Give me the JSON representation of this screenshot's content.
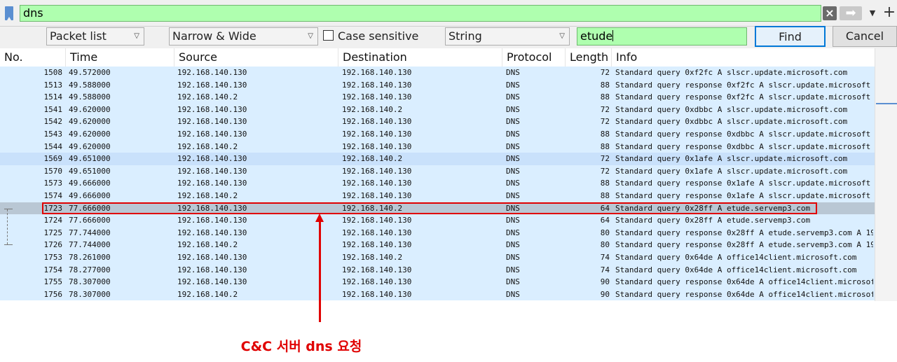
{
  "filter": {
    "value": "dns",
    "icons": {
      "bookmark": "bookmark-icon",
      "clear": "clear-x-icon",
      "apply": "arrow-right-icon",
      "history": "chevron-down-icon",
      "add": "plus-icon"
    }
  },
  "findbar": {
    "search_in": "Packet list",
    "char_width": "Narrow & Wide",
    "case_sensitive_label": "Case sensitive",
    "search_type": "String",
    "search_value": "etude",
    "find_label": "Find",
    "cancel_label": "Cancel"
  },
  "table": {
    "columns": [
      "No.",
      "Time",
      "Source",
      "Destination",
      "Protocol",
      "Length",
      "Info"
    ],
    "rows": [
      {
        "no": "1508",
        "time": "49.572000",
        "src": "192.168.140.130",
        "dst": "192.168.140.130",
        "proto": "DNS",
        "len": "72",
        "info": "Standard query 0xf2fc A slscr.update.microsoft.com"
      },
      {
        "no": "1513",
        "time": "49.588000",
        "src": "192.168.140.130",
        "dst": "192.168.140.130",
        "proto": "DNS",
        "len": "88",
        "info": "Standard query response 0xf2fc A slscr.update.microsoft"
      },
      {
        "no": "1514",
        "time": "49.588000",
        "src": "192.168.140.2",
        "dst": "192.168.140.130",
        "proto": "DNS",
        "len": "88",
        "info": "Standard query response 0xf2fc A slscr.update.microsoft"
      },
      {
        "no": "1541",
        "time": "49.620000",
        "src": "192.168.140.130",
        "dst": "192.168.140.2",
        "proto": "DNS",
        "len": "72",
        "info": "Standard query 0xdbbc A slscr.update.microsoft.com"
      },
      {
        "no": "1542",
        "time": "49.620000",
        "src": "192.168.140.130",
        "dst": "192.168.140.130",
        "proto": "DNS",
        "len": "72",
        "info": "Standard query 0xdbbc A slscr.update.microsoft.com"
      },
      {
        "no": "1543",
        "time": "49.620000",
        "src": "192.168.140.130",
        "dst": "192.168.140.130",
        "proto": "DNS",
        "len": "88",
        "info": "Standard query response 0xdbbc A slscr.update.microsoft"
      },
      {
        "no": "1544",
        "time": "49.620000",
        "src": "192.168.140.2",
        "dst": "192.168.140.130",
        "proto": "DNS",
        "len": "88",
        "info": "Standard query response 0xdbbc A slscr.update.microsoft"
      },
      {
        "no": "1569",
        "time": "49.651000",
        "src": "192.168.140.130",
        "dst": "192.168.140.2",
        "proto": "DNS",
        "len": "72",
        "info": "Standard query 0x1afe A slscr.update.microsoft.com"
      },
      {
        "no": "1570",
        "time": "49.651000",
        "src": "192.168.140.130",
        "dst": "192.168.140.130",
        "proto": "DNS",
        "len": "72",
        "info": "Standard query 0x1afe A slscr.update.microsoft.com"
      },
      {
        "no": "1573",
        "time": "49.666000",
        "src": "192.168.140.130",
        "dst": "192.168.140.130",
        "proto": "DNS",
        "len": "88",
        "info": "Standard query response 0x1afe A slscr.update.microsoft"
      },
      {
        "no": "1574",
        "time": "49.666000",
        "src": "192.168.140.2",
        "dst": "192.168.140.130",
        "proto": "DNS",
        "len": "88",
        "info": "Standard query response 0x1afe A slscr.update.microsoft"
      },
      {
        "no": "1723",
        "time": "77.666000",
        "src": "192.168.140.130",
        "dst": "192.168.140.2",
        "proto": "DNS",
        "len": "64",
        "info": "Standard query 0x28ff A etude.servemp3.com"
      },
      {
        "no": "1724",
        "time": "77.666000",
        "src": "192.168.140.130",
        "dst": "192.168.140.130",
        "proto": "DNS",
        "len": "64",
        "info": "Standard query 0x28ff A etude.servemp3.com"
      },
      {
        "no": "1725",
        "time": "77.744000",
        "src": "192.168.140.130",
        "dst": "192.168.140.130",
        "proto": "DNS",
        "len": "80",
        "info": "Standard query response 0x28ff A etude.servemp3.com A 19"
      },
      {
        "no": "1726",
        "time": "77.744000",
        "src": "192.168.140.2",
        "dst": "192.168.140.130",
        "proto": "DNS",
        "len": "80",
        "info": "Standard query response 0x28ff A etude.servemp3.com A 19"
      },
      {
        "no": "1753",
        "time": "78.261000",
        "src": "192.168.140.130",
        "dst": "192.168.140.2",
        "proto": "DNS",
        "len": "74",
        "info": "Standard query 0x64de A office14client.microsoft.com"
      },
      {
        "no": "1754",
        "time": "78.277000",
        "src": "192.168.140.130",
        "dst": "192.168.140.130",
        "proto": "DNS",
        "len": "74",
        "info": "Standard query 0x64de A office14client.microsoft.com"
      },
      {
        "no": "1755",
        "time": "78.307000",
        "src": "192.168.140.130",
        "dst": "192.168.140.130",
        "proto": "DNS",
        "len": "90",
        "info": "Standard query response 0x64de A office14client.microsof"
      },
      {
        "no": "1756",
        "time": "78.307000",
        "src": "192.168.140.2",
        "dst": "192.168.140.130",
        "proto": "DNS",
        "len": "90",
        "info": "Standard query response 0x64de A office14client.microsof"
      }
    ],
    "selected_no": "1723",
    "alt_no": "1569"
  },
  "annotation": {
    "caption": "C&C 서버 dns 요청",
    "color": "#e00000"
  }
}
